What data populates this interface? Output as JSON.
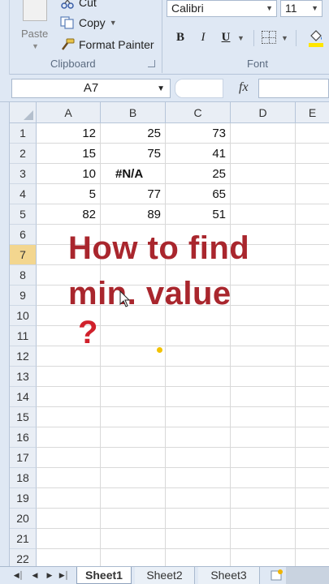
{
  "ribbon": {
    "clipboard": {
      "paste_label": "Paste",
      "cut_label": "Cut",
      "copy_label": "Copy",
      "format_painter_label": "Format Painter",
      "group_label": "Clipboard"
    },
    "font": {
      "font_name": "Calibri",
      "font_size": "11",
      "bold_label": "B",
      "italic_label": "I",
      "underline_label": "U",
      "group_label": "Font"
    }
  },
  "formula_bar": {
    "name_box": "A7",
    "fx_label": "fx",
    "formula": ""
  },
  "sheet": {
    "columns": [
      "A",
      "B",
      "C",
      "D",
      "E"
    ],
    "rows": [
      "1",
      "2",
      "3",
      "4",
      "5",
      "6",
      "7",
      "8",
      "9",
      "10",
      "11",
      "12",
      "13",
      "14",
      "15",
      "16",
      "17",
      "18",
      "19",
      "20",
      "21",
      "22"
    ],
    "selected_row": "7",
    "cells": {
      "A1": "12",
      "B1": "25",
      "C1": "73",
      "A2": "15",
      "B2": "75",
      "C2": "41",
      "A3": "10",
      "B3": "#N/A",
      "C3": "25",
      "A4": "5",
      "B4": "77",
      "C4": "65",
      "A5": "82",
      "B5": "89",
      "C5": "51"
    }
  },
  "overlay": {
    "line1": "How to find",
    "line2": "min. value",
    "question_mark": "?"
  },
  "sheet_tabs": {
    "tabs": [
      "Sheet1",
      "Sheet2",
      "Sheet3"
    ],
    "active_tab": "Sheet1"
  },
  "colors": {
    "ribbon_bg": "#dfe8f4",
    "overlay_text": "#a9262d",
    "question_mark": "#d0202b",
    "selected_row_header": "#f3d68f"
  },
  "icons": [
    "cut-icon",
    "copy-icon",
    "format-painter-icon",
    "paste-icon",
    "fill-color-icon",
    "borders-icon",
    "new-sheet-icon",
    "mouse-cursor-icon"
  ]
}
